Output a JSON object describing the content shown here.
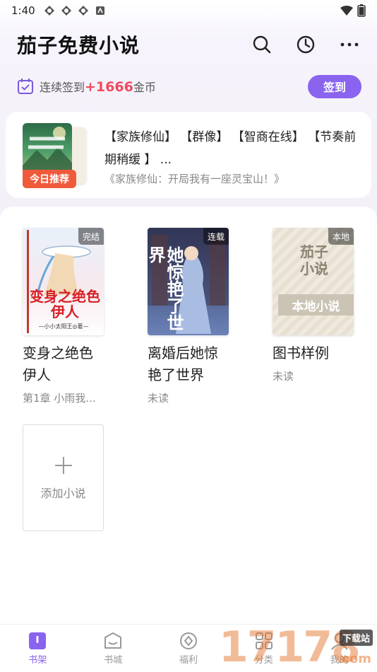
{
  "status_bar": {
    "time": "1:40"
  },
  "header": {
    "title": "茄子免费小说"
  },
  "checkin": {
    "prefix": "连续签到",
    "coins": "+1666",
    "suffix": "金币",
    "button_label": "签到"
  },
  "recommend": {
    "badge": "今日推荐",
    "tags": "【家族修仙】 【群像】 【智商在线】 【节奏前期稍缓 】 ...",
    "book_name": "《家族修仙：开局我有一座灵宝山！》"
  },
  "books": [
    {
      "title": "变身之绝色伊人",
      "status": "第1章 小雨我...",
      "tag": "完结",
      "cover_text": "变身之绝色伊人",
      "cover_author": "—小小太阳王◎著—"
    },
    {
      "title": "离婚后她惊艳了世界",
      "status": "未读",
      "tag": "连载",
      "cover_text": "她惊艳了世界"
    },
    {
      "title": "图书样例",
      "status": "未读",
      "tag": "本地",
      "cover_text": "茄子小说",
      "cover_band": "本地小说"
    }
  ],
  "add_novel": {
    "label": "添加小说"
  },
  "tabs": [
    {
      "label": "书架",
      "active": true,
      "icon": "bookshelf-icon"
    },
    {
      "label": "书城",
      "active": false,
      "icon": "bookstore-icon"
    },
    {
      "label": "福利",
      "active": false,
      "icon": "welfare-icon"
    },
    {
      "label": "分类",
      "active": false,
      "icon": "category-icon"
    },
    {
      "label": "我的",
      "active": false,
      "icon": "profile-icon"
    }
  ],
  "watermark": {
    "digits": "17178",
    "tag": "下载站",
    "domain": ".com"
  },
  "colors": {
    "accent": "#8a63ef",
    "coins": "#ef4b5f",
    "badge": "#f05a3a"
  }
}
